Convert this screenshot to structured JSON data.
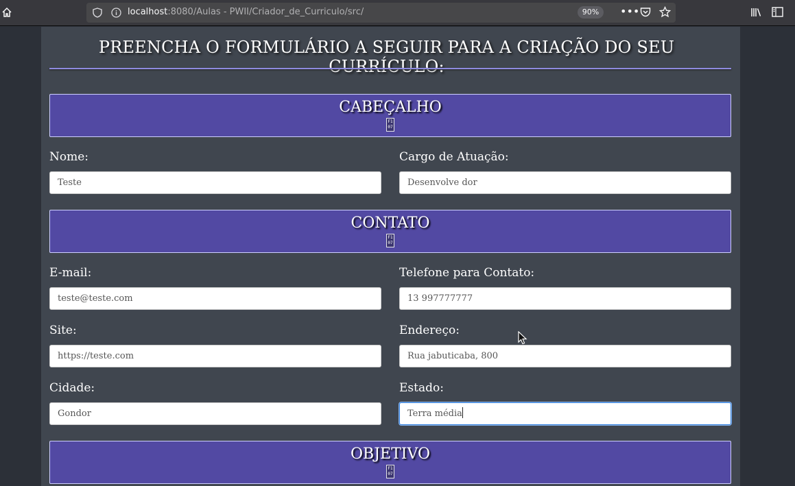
{
  "browser": {
    "url_host": "localhost",
    "url_path": ":8080/Aulas - PWII/Criador_de_Curriculo/src/",
    "zoom": "90%",
    "icons": [
      "home-icon",
      "shield-icon",
      "info-icon",
      "more-icon",
      "pocket-icon",
      "star-icon",
      "library-icon",
      "sidebar-icon"
    ]
  },
  "page": {
    "title": "PREENCHA O FORMULÁRIO A SEGUIR PARA A CRIAÇÃO DO SEU CURRÍCULO:",
    "sections": {
      "cabecalho": "CABEÇALHO",
      "contato": "CONTATO",
      "objetivo": "OBJETIVO"
    },
    "section_glyph": "F1\n07",
    "fields": {
      "nome": {
        "label": "Nome:",
        "value": "Teste"
      },
      "cargo": {
        "label": "Cargo de Atuação:",
        "value": "Desenvolve dor"
      },
      "email": {
        "label": "E-mail:",
        "value": "teste@teste.com"
      },
      "telefone": {
        "label": "Telefone para Contato:",
        "value": "13 997777777"
      },
      "site": {
        "label": "Site:",
        "value": "https://teste.com"
      },
      "endereco": {
        "label": "Endereço:",
        "value": "Rua jabuticaba, 800"
      },
      "cidade": {
        "label": "Cidade:",
        "value": "Gondor"
      },
      "estado": {
        "label": "Estado:",
        "value": "Terra média"
      }
    }
  },
  "colors": {
    "section_bg": "#5249a3",
    "page_bg": "#40464f",
    "focus": "#2f7bd7"
  }
}
